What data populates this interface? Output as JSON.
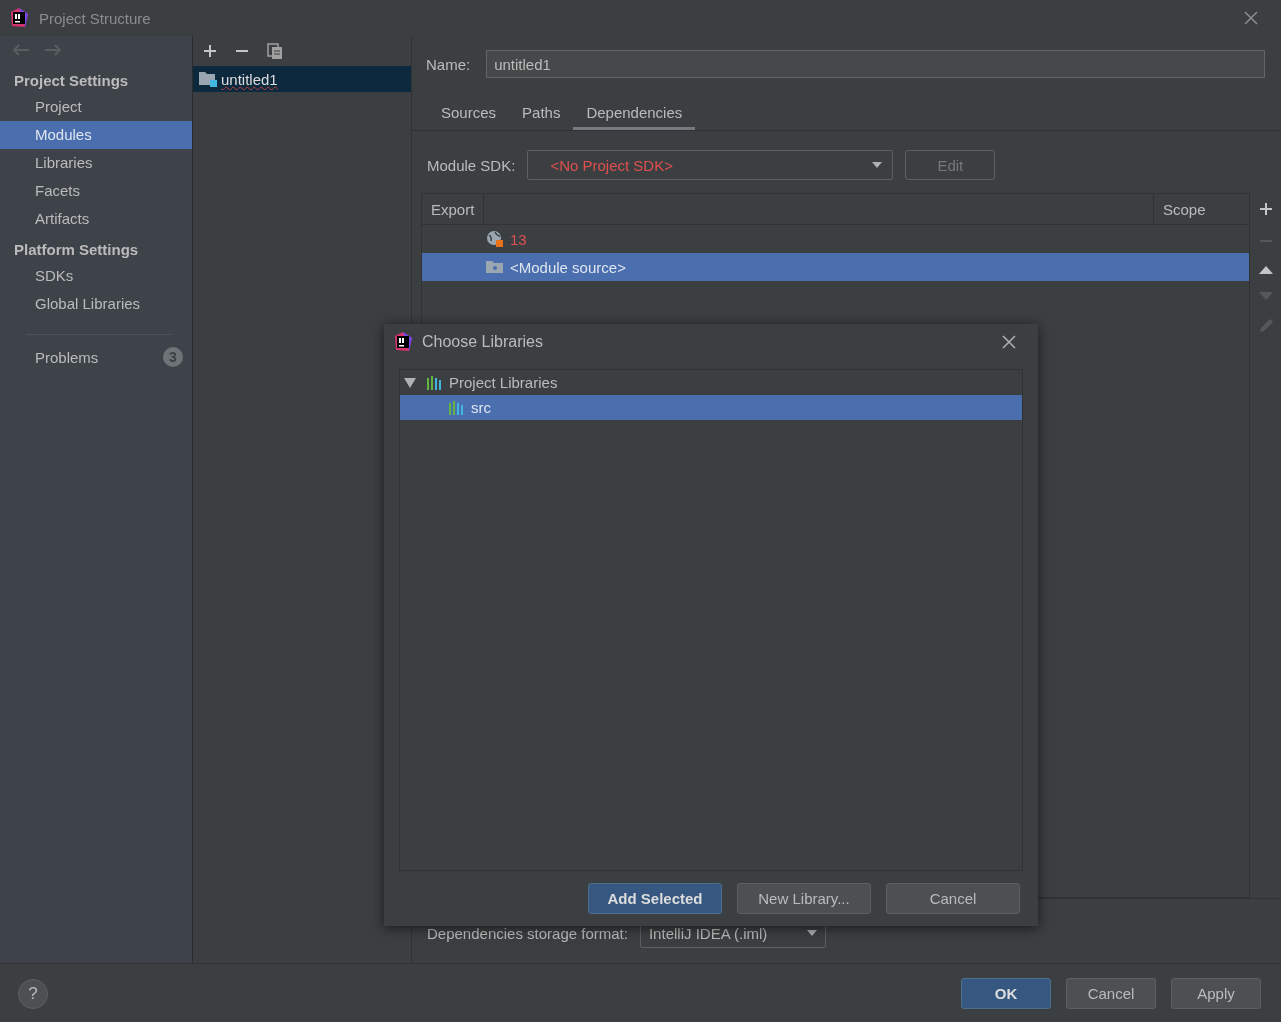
{
  "window": {
    "title": "Project Structure"
  },
  "sidebar": {
    "sections": [
      {
        "heading": "Project Settings",
        "items": [
          {
            "label": "Project",
            "selected": false
          },
          {
            "label": "Modules",
            "selected": true
          },
          {
            "label": "Libraries",
            "selected": false
          },
          {
            "label": "Facets",
            "selected": false
          },
          {
            "label": "Artifacts",
            "selected": false
          }
        ]
      },
      {
        "heading": "Platform Settings",
        "items": [
          {
            "label": "SDKs",
            "selected": false
          },
          {
            "label": "Global Libraries",
            "selected": false
          }
        ]
      }
    ],
    "problems": {
      "label": "Problems",
      "count": "3"
    }
  },
  "modules": [
    {
      "label": "untitled1",
      "selected": true
    }
  ],
  "module": {
    "name_label": "Name:",
    "name": "untitled1",
    "tabs": [
      {
        "label": "Sources",
        "selected": false
      },
      {
        "label": "Paths",
        "selected": false
      },
      {
        "label": "Dependencies",
        "selected": true
      }
    ],
    "sdk_label": "Module SDK:",
    "sdk_value": "<No Project SDK>",
    "edit_button": {
      "label": "Edit",
      "disabled": true
    },
    "columns": [
      "Export",
      "Scope"
    ],
    "rows": [
      {
        "kind": "sdk",
        "label": "13",
        "selected": false
      },
      {
        "kind": "source",
        "label": "<Module source>",
        "selected": true
      }
    ],
    "storage_label": "Dependencies storage format:",
    "storage_value": "IntelliJ IDEA (.iml)"
  },
  "dialog": {
    "title": "Choose Libraries",
    "tree": [
      {
        "label": "Project Libraries",
        "expanded": true,
        "selected": false,
        "children": [
          {
            "label": "src",
            "selected": true
          }
        ]
      }
    ],
    "buttons": [
      {
        "label": "Add Selected",
        "primary": true
      },
      {
        "label": "New Library...",
        "primary": false
      },
      {
        "label": "Cancel",
        "primary": false
      }
    ]
  },
  "help": "?",
  "buttons": [
    {
      "label": "OK",
      "primary": true
    },
    {
      "label": "Cancel",
      "primary": false
    },
    {
      "label": "Apply",
      "primary": false
    }
  ]
}
